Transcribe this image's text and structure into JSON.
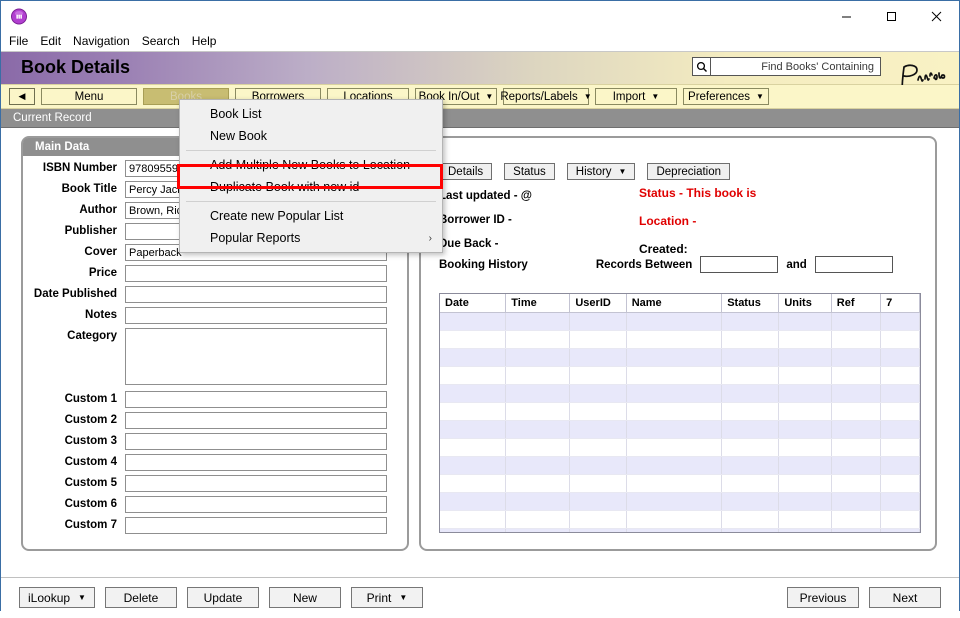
{
  "window": {
    "app_icon": "app-purple-circle-icon",
    "minimize": "—",
    "maximize": "□",
    "close": "✕"
  },
  "menubar": {
    "items": [
      {
        "label": "File"
      },
      {
        "label": "Edit"
      },
      {
        "label": "Navigation"
      },
      {
        "label": "Search"
      },
      {
        "label": "Help"
      }
    ]
  },
  "header": {
    "title": "Book Details",
    "search_icon": "search-magnifier-icon",
    "search_value": "",
    "search_placeholder": "Find Books' Containing",
    "logo_text": "Peninsula"
  },
  "toolbar": {
    "back_icon": "◀",
    "items": [
      {
        "label": "Menu",
        "caret": false,
        "active": false
      },
      {
        "label": "Books",
        "caret": false,
        "active": true
      },
      {
        "label": "Borrowers",
        "caret": false,
        "active": false
      },
      {
        "label": "Locations",
        "caret": false,
        "active": false
      },
      {
        "label": "Book In/Out",
        "caret": true,
        "active": false
      },
      {
        "label": "Reports/Labels",
        "caret": true,
        "active": false
      },
      {
        "label": "Import",
        "caret": true,
        "active": false
      },
      {
        "label": "Preferences",
        "caret": true,
        "active": false
      }
    ]
  },
  "current_record_bar": {
    "label": "Current Record"
  },
  "books_menu": {
    "items": [
      {
        "label": "Book List",
        "submenu": false,
        "highlighted": false
      },
      {
        "label": "New Book",
        "submenu": false,
        "highlighted": false
      },
      {
        "separator": true
      },
      {
        "label": "Add Multiple New Books to Location",
        "submenu": false,
        "highlighted": false
      },
      {
        "label": "Duplicate Book with new id",
        "submenu": false,
        "highlighted": true
      },
      {
        "separator": true
      },
      {
        "label": "Create new Popular List",
        "submenu": false,
        "highlighted": false
      },
      {
        "label": "Popular Reports",
        "submenu": true,
        "highlighted": false
      }
    ],
    "submenu_arrow": "›"
  },
  "main_data": {
    "title": "Main Data",
    "fields": [
      {
        "label": "ISBN Number",
        "value": "9780955944",
        "type": "input"
      },
      {
        "label": "Book Title",
        "value": "Percy Jackso",
        "type": "input"
      },
      {
        "label": "Author",
        "value": "Brown, Rick R",
        "type": "input"
      },
      {
        "label": "Publisher",
        "value": "",
        "type": "input"
      },
      {
        "label": "Cover",
        "value": "Paperback",
        "type": "input"
      },
      {
        "label": "Price",
        "value": "",
        "type": "input"
      },
      {
        "label": "Date Published",
        "value": "",
        "type": "input"
      },
      {
        "label": "Notes",
        "value": "",
        "type": "input"
      },
      {
        "label": "Category",
        "value": "",
        "type": "textarea"
      },
      {
        "label": "Custom 1",
        "value": "",
        "type": "input"
      },
      {
        "label": "Custom 2",
        "value": "",
        "type": "input"
      },
      {
        "label": "Custom 3",
        "value": "",
        "type": "input"
      },
      {
        "label": "Custom 4",
        "value": "",
        "type": "input"
      },
      {
        "label": "Custom 5",
        "value": "",
        "type": "input"
      },
      {
        "label": "Custom 6",
        "value": "",
        "type": "input"
      },
      {
        "label": "Custom 7",
        "value": "",
        "type": "input"
      }
    ]
  },
  "details_panel": {
    "tabs": [
      {
        "label": "Details",
        "caret": false
      },
      {
        "label": "Status",
        "caret": false
      },
      {
        "label": "History",
        "caret": true
      },
      {
        "label": "Depreciation",
        "caret": false
      }
    ],
    "info": {
      "last_updated": "Last updated -  @",
      "borrower_id": "Borrower ID -",
      "due_back": "Due Back -"
    },
    "status": {
      "status_line": "Status - This book is",
      "location_line": "Location -",
      "created_line": "Created:"
    },
    "booking": {
      "title": "Booking History",
      "records_between_label": "Records Between",
      "from_value": "",
      "and_label": "and",
      "to_value": ""
    },
    "grid": {
      "columns": [
        "Date",
        "Time",
        "UserID",
        "Name",
        "Status",
        "Units",
        "Ref",
        "7"
      ],
      "rows": [
        [
          "",
          "",
          "",
          "",
          "",
          "",
          "",
          ""
        ],
        [
          "",
          "",
          "",
          "",
          "",
          "",
          "",
          ""
        ],
        [
          "",
          "",
          "",
          "",
          "",
          "",
          "",
          ""
        ],
        [
          "",
          "",
          "",
          "",
          "",
          "",
          "",
          ""
        ],
        [
          "",
          "",
          "",
          "",
          "",
          "",
          "",
          ""
        ],
        [
          "",
          "",
          "",
          "",
          "",
          "",
          "",
          ""
        ],
        [
          "",
          "",
          "",
          "",
          "",
          "",
          "",
          ""
        ],
        [
          "",
          "",
          "",
          "",
          "",
          "",
          "",
          ""
        ],
        [
          "",
          "",
          "",
          "",
          "",
          "",
          "",
          ""
        ],
        [
          "",
          "",
          "",
          "",
          "",
          "",
          "",
          ""
        ],
        [
          "",
          "",
          "",
          "",
          "",
          "",
          "",
          ""
        ],
        [
          "",
          "",
          "",
          "",
          "",
          "",
          "",
          ""
        ],
        [
          "",
          "",
          "",
          "",
          "",
          "",
          "",
          ""
        ]
      ]
    }
  },
  "footer": {
    "left_buttons": [
      {
        "label": "iLookup",
        "caret": true
      },
      {
        "label": "Delete",
        "caret": false
      },
      {
        "label": "Update",
        "caret": false
      },
      {
        "label": "New",
        "caret": false
      },
      {
        "label": "Print",
        "caret": true
      }
    ],
    "right_buttons": [
      {
        "label": "Previous",
        "caret": false
      },
      {
        "label": "Next",
        "caret": false
      }
    ]
  },
  "colors": {
    "header_purple": "#8a6aa8",
    "header_cream": "#f9f2c4",
    "toolbar_bg": "#fbf6c8",
    "active_tab": "#c8bd72",
    "gray_bar": "#8f8f8f",
    "status_red": "#e00000",
    "highlight_red": "#ff0000",
    "grid_alt_row": "#e8e8fa"
  }
}
